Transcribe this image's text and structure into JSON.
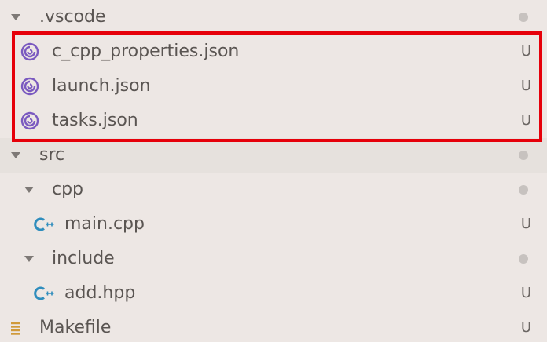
{
  "colors": {
    "background": "#ede7e4",
    "selected_row": "#e6e1dd",
    "text": "#5a5552",
    "highlight_box": "#e6000a",
    "json_icon": "#7b5ac0",
    "cpp_icon": "#2f8dbd",
    "makefile_icon": "#d09a3a"
  },
  "tree": {
    "vscode_folder": {
      "label": ".vscode",
      "icon": "chevron-down-icon"
    },
    "vscode_files": [
      {
        "label": "c_cpp_properties.json",
        "status": "U",
        "icon": "json-settings-icon"
      },
      {
        "label": "launch.json",
        "status": "U",
        "icon": "json-settings-icon"
      },
      {
        "label": "tasks.json",
        "status": "U",
        "icon": "json-settings-icon"
      }
    ],
    "src_folder": {
      "label": "src",
      "icon": "chevron-down-icon"
    },
    "cpp_folder": {
      "label": "cpp",
      "icon": "chevron-down-icon"
    },
    "main_file": {
      "label": "main.cpp",
      "status": "U",
      "icon": "cpp-file-icon"
    },
    "include_folder": {
      "label": "include",
      "icon": "chevron-down-icon"
    },
    "add_file": {
      "label": "add.hpp",
      "status": "U",
      "icon": "cpp-file-icon"
    },
    "makefile": {
      "label": "Makefile",
      "status": "U",
      "icon": "makefile-icon"
    }
  }
}
